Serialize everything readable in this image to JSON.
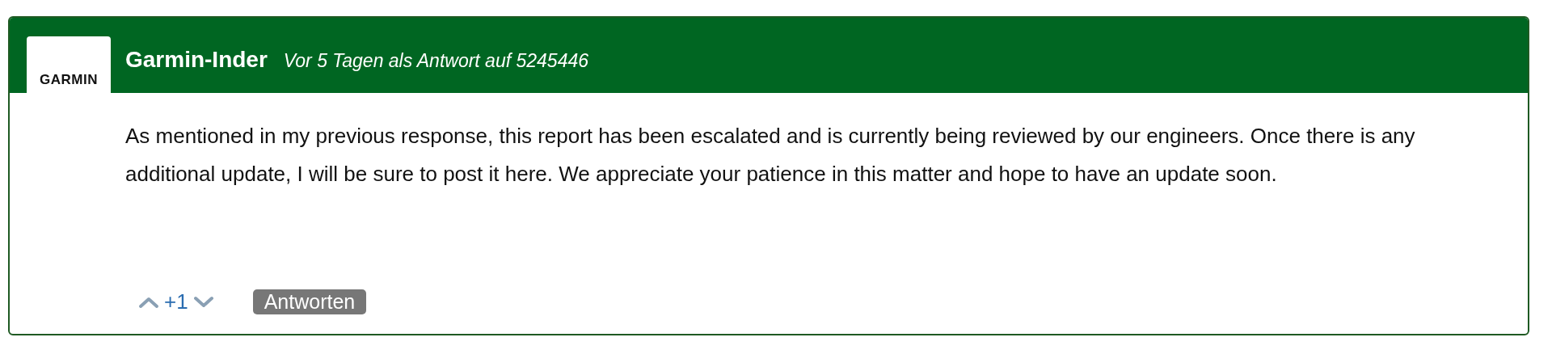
{
  "post": {
    "avatar": {
      "logo": "GARMIN"
    },
    "author": "Garmin-Inder",
    "meta": "Vor 5 Tagen als Antwort auf 5245446",
    "body": "As mentioned in my previous response, this report has been escalated and is currently being reviewed by our engineers. Once there is any additional update, I will be sure to post it here. We appreciate your patience in this matter and hope to have an update soon.",
    "votes": {
      "score": "+1"
    },
    "reply_button": "Antworten"
  }
}
